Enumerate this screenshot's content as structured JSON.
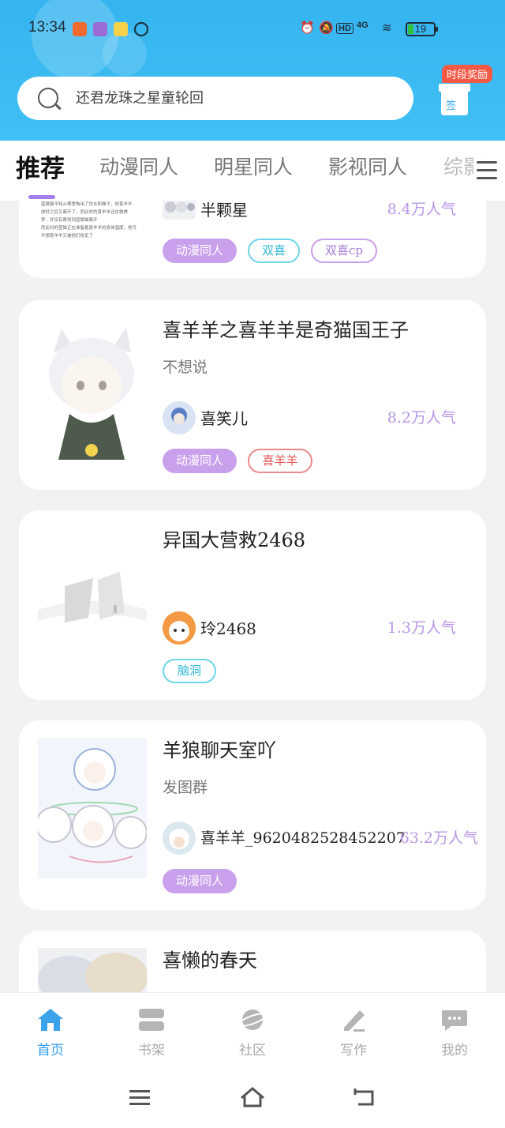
{
  "status_bar": {
    "time": "13:34",
    "battery": "19",
    "network": "4G",
    "hd_badge": "HD"
  },
  "search": {
    "placeholder": "还君龙珠之星童轮回"
  },
  "reward": {
    "tag": "时段奖励",
    "sign": "签"
  },
  "tabs": [
    {
      "label": "推荐",
      "active": true
    },
    {
      "label": "动漫同人"
    },
    {
      "label": "明星同人"
    },
    {
      "label": "影视同人"
    },
    {
      "label": "综影"
    }
  ],
  "feed": [
    {
      "author": "半颗星",
      "popularity": "8.4万人气",
      "cover_text": [
        "蓝猫猫不知从哪里掏出了饮水和梯子，他喜羊羊",
        "放好之后又离开了，而此时的喜羊羊还在做美",
        "梦，并没有察觉到蓝猫猫离开",
        "而此时的蓝猫正在准备着喜羊羊的身体温度，他可",
        "不想喜羊羊又被他们抢走了"
      ],
      "tags": [
        "动漫同人",
        "双喜",
        "双喜cp"
      ]
    },
    {
      "title": "喜羊羊之喜羊羊是奇猫国王子",
      "subtitle": "不想说",
      "author": "喜笑儿",
      "popularity": "8.2万人气",
      "tags": [
        "动漫同人",
        "喜羊羊"
      ]
    },
    {
      "title": "异国大营救2468",
      "subtitle": "",
      "author": "玲2468",
      "popularity": "1.3万人气",
      "tags": [
        "脑洞"
      ]
    },
    {
      "title": "羊狼聊天室吖",
      "subtitle": "发图群",
      "author": "喜羊羊_9620482528452207",
      "popularity": "63.2万人气",
      "tags": [
        "动漫同人"
      ]
    },
    {
      "title": "喜懒的春天"
    }
  ],
  "bottom_nav": [
    {
      "label": "首页",
      "icon": "home-icon",
      "active": true
    },
    {
      "label": "书架",
      "icon": "bookshelf-icon"
    },
    {
      "label": "社区",
      "icon": "planet-icon"
    },
    {
      "label": "写作",
      "icon": "pencil-icon"
    },
    {
      "label": "我的",
      "icon": "chat-bubble-icon"
    }
  ],
  "colors": {
    "header": "#35b4ef",
    "accent_purple": "#c9a0ec",
    "popularity": "#b896e6",
    "nav_active": "#2e9be8"
  }
}
